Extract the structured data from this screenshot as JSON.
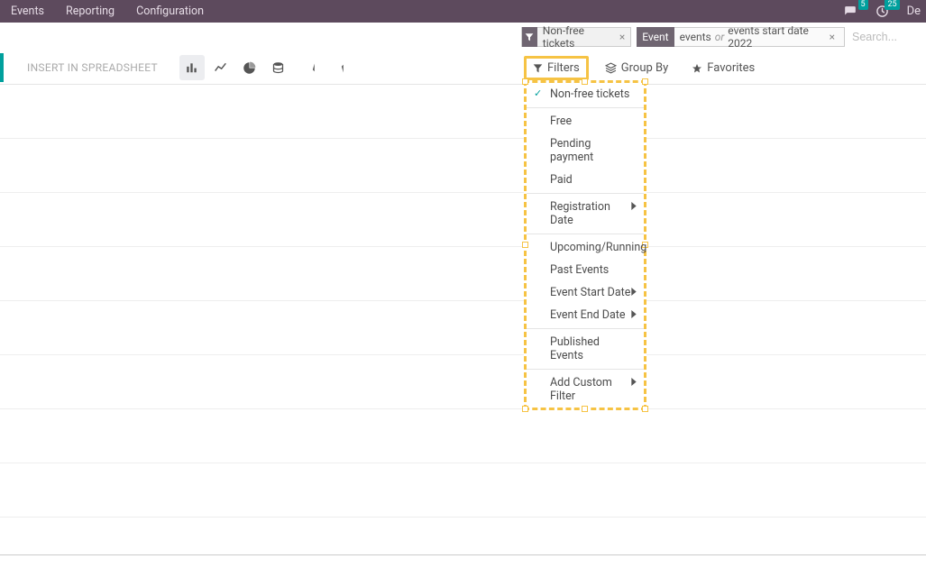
{
  "topnav": {
    "items": [
      "Events",
      "Reporting",
      "Configuration"
    ],
    "messages_badge": "5",
    "activities_badge": "25",
    "user_initial": "De"
  },
  "search": {
    "chip1_label": "Non-free tickets",
    "facet_label": "Event",
    "facet_value1": "events",
    "facet_or": "or",
    "facet_value2": "events start date 2022",
    "placeholder": "Search..."
  },
  "controlpanel": {
    "insert_label": "INSERT IN SPREADSHEET",
    "filters_label": "Filters",
    "groupby_label": "Group By",
    "favorites_label": "Favorites"
  },
  "filters_menu": {
    "items": [
      {
        "label": "Non-free tickets",
        "checked": true
      },
      {
        "sep": true
      },
      {
        "label": "Free"
      },
      {
        "label": "Pending payment"
      },
      {
        "label": "Paid"
      },
      {
        "sep": true
      },
      {
        "label": "Registration Date",
        "submenu": true
      },
      {
        "sep": true
      },
      {
        "label": "Upcoming/Running"
      },
      {
        "label": "Past Events"
      },
      {
        "label": "Event Start Date",
        "submenu": true
      },
      {
        "label": "Event End Date",
        "submenu": true
      },
      {
        "sep": true
      },
      {
        "label": "Published Events"
      },
      {
        "sep": true
      },
      {
        "label": "Add Custom Filter",
        "submenu": true
      }
    ]
  }
}
